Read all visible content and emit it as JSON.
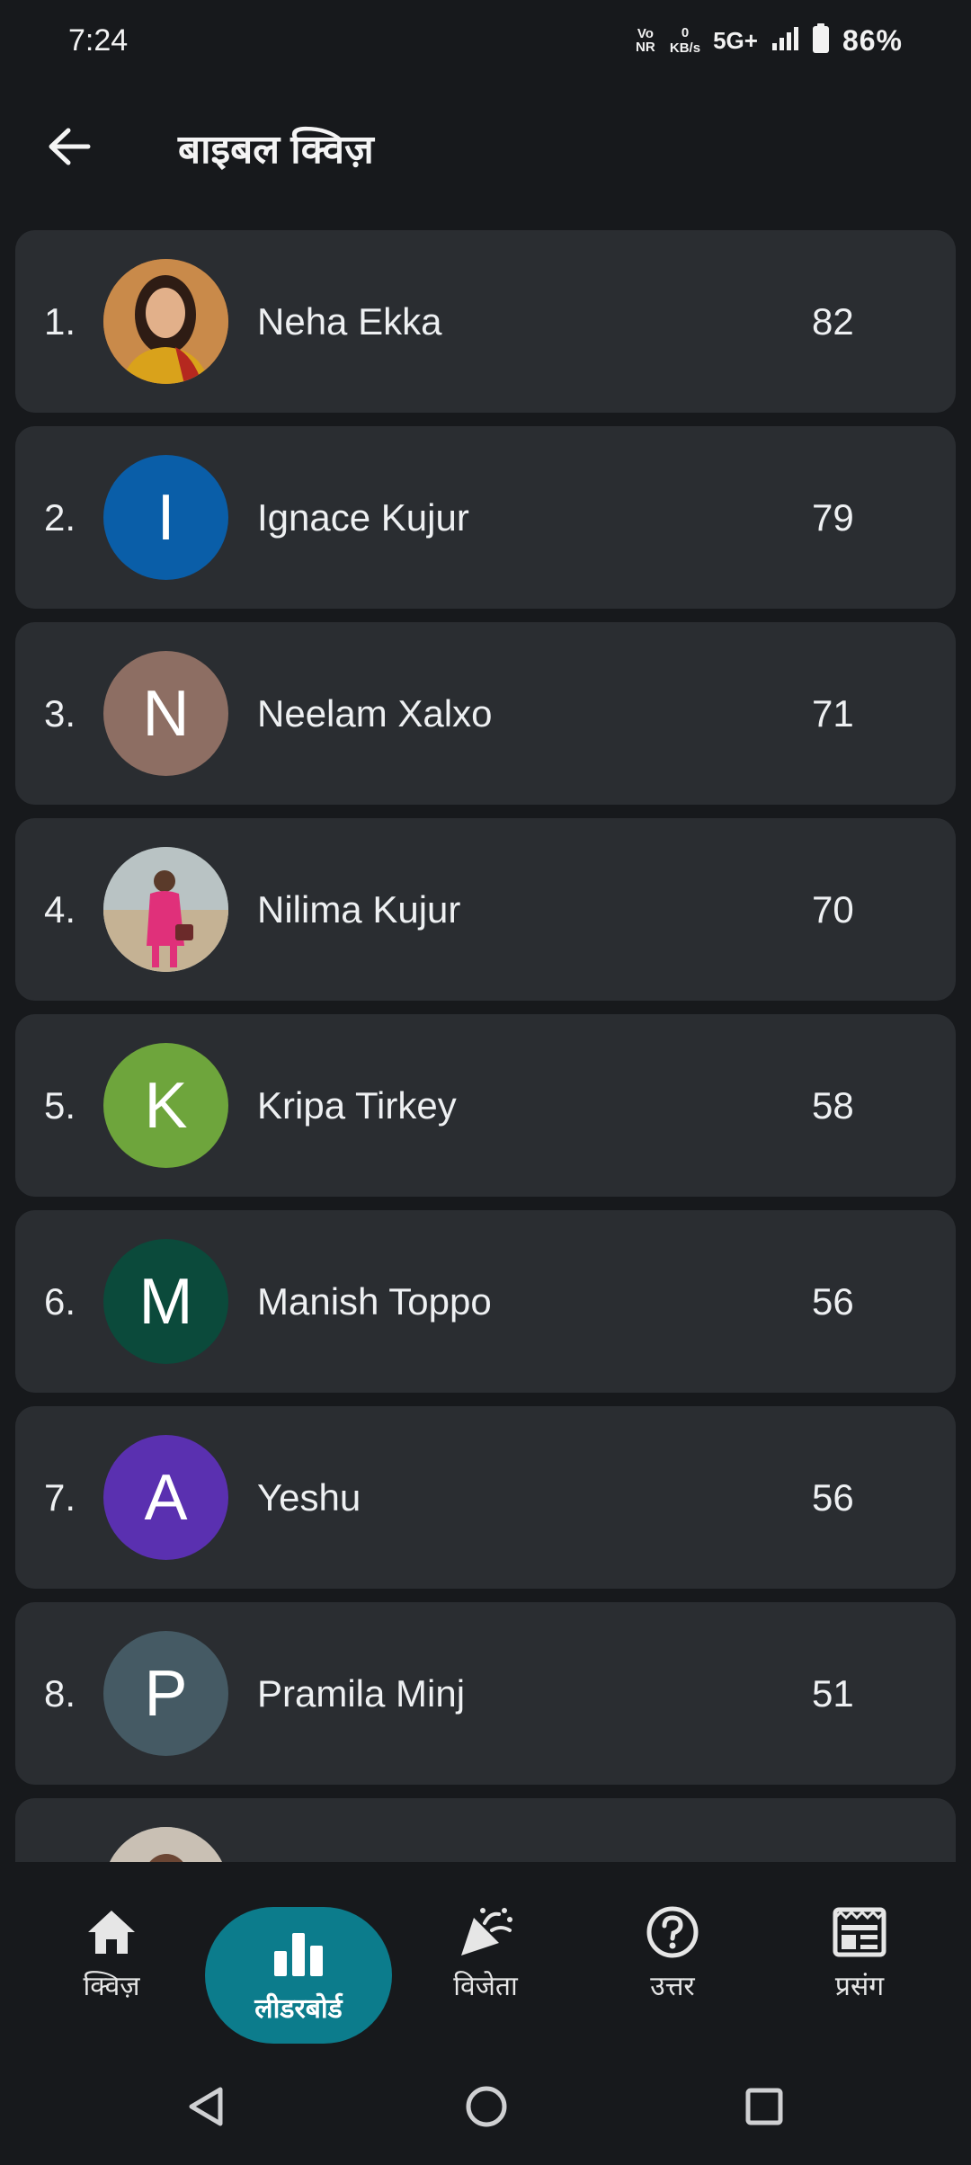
{
  "status_bar": {
    "time": "7:24",
    "vonr": "Vo\nNR",
    "speed_value": "0",
    "speed_unit": "KB/s",
    "network": "5G+",
    "battery": "86%"
  },
  "app_bar": {
    "back_icon": "arrow-left-icon",
    "title": "बाइबल क्विज़"
  },
  "leaderboard": {
    "rows": [
      {
        "rank": "1.",
        "name": "Neha Ekka",
        "score": "82",
        "avatar_letter": "",
        "avatar_color": "#c4742e"
      },
      {
        "rank": "2.",
        "name": "Ignace Kujur",
        "score": "79",
        "avatar_letter": "I",
        "avatar_color": "#0a5ea8"
      },
      {
        "rank": "3.",
        "name": "Neelam Xalxo",
        "score": "71",
        "avatar_letter": "N",
        "avatar_color": "#8d6e63"
      },
      {
        "rank": "4.",
        "name": "Nilima Kujur",
        "score": "70",
        "avatar_letter": "",
        "avatar_color": "#b8a48c"
      },
      {
        "rank": "5.",
        "name": "Kripa Tirkey",
        "score": "58",
        "avatar_letter": "K",
        "avatar_color": "#6ea53c"
      },
      {
        "rank": "6.",
        "name": "Manish Toppo",
        "score": "56",
        "avatar_letter": "M",
        "avatar_color": "#0b4a3b"
      },
      {
        "rank": "7.",
        "name": "Yeshu",
        "score": "56",
        "avatar_letter": "A",
        "avatar_color": "#5a30b0"
      },
      {
        "rank": "8.",
        "name": "Pramila Minj",
        "score": "51",
        "avatar_letter": "P",
        "avatar_color": "#455a64"
      }
    ]
  },
  "bottom_nav": {
    "items": [
      {
        "label": "क्विज़",
        "icon": "home-icon"
      },
      {
        "label": "लीडरबोर्ड",
        "icon": "leaderboard-icon"
      },
      {
        "label": "विजेता",
        "icon": "celebration-icon"
      },
      {
        "label": "उत्तर",
        "icon": "help-icon"
      },
      {
        "label": "प्रसंग",
        "icon": "newspaper-icon"
      }
    ],
    "active_index": 1,
    "active_color": "#0c7c8c"
  },
  "system_nav": {
    "back": "triangle-back-icon",
    "home": "circle-home-icon",
    "recents": "square-recents-icon"
  }
}
